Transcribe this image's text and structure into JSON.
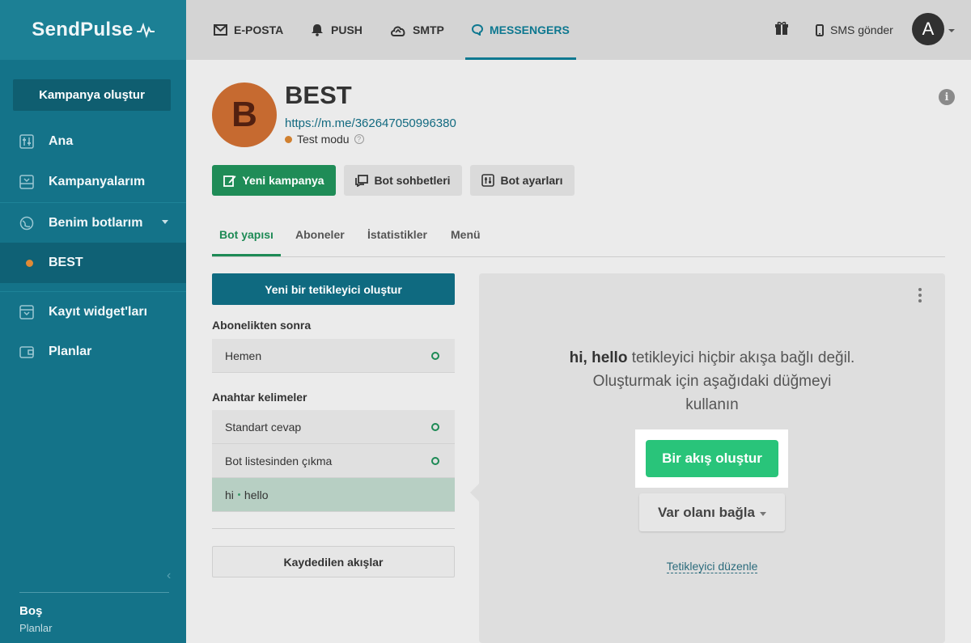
{
  "brand": {
    "logo_text": "SendPulse"
  },
  "sidebar": {
    "create_button": "Kampanya oluştur",
    "items": [
      {
        "label": "Ana",
        "icon": "sliders-icon"
      },
      {
        "label": "Kampanyalarım",
        "icon": "inbox-icon"
      },
      {
        "label": "Benim botlarım",
        "icon": "globe-icon"
      },
      {
        "label": "BEST",
        "icon": "status-dot"
      },
      {
        "label": "Kayıt widget'ları",
        "icon": "widget-icon"
      },
      {
        "label": "Planlar",
        "icon": "wallet-icon"
      }
    ],
    "footer": {
      "plan_name": "Boş",
      "plan_link": "Planlar"
    }
  },
  "topnav": {
    "items": [
      {
        "label": "E-POSTA",
        "icon": "mail-icon"
      },
      {
        "label": "PUSH",
        "icon": "bell-icon"
      },
      {
        "label": "SMTP",
        "icon": "cloud-upload-icon"
      },
      {
        "label": "MESSENGERS",
        "icon": "chat-icon"
      }
    ],
    "sms_label": "SMS gönder",
    "avatar_letter": "A"
  },
  "bot": {
    "avatar_letter": "B",
    "name": "BEST",
    "link": "https://m.me/362647050996380",
    "status": "Test modu",
    "status_color": "#d08030"
  },
  "actions": {
    "new_campaign": "Yeni kampanya",
    "bot_chats": "Bot sohbetleri",
    "bot_settings": "Bot ayarları"
  },
  "tabs": [
    "Bot yapısı",
    "Aboneler",
    "İstatistikler",
    "Menü"
  ],
  "triggers": {
    "create_button": "Yeni bir tetikleyici oluştur",
    "after_subscribe_title": "Abonelikten sonra",
    "after_subscribe_items": [
      "Hemen"
    ],
    "keywords_title": "Anahtar kelimeler",
    "keyword_items": [
      "Standart cevap",
      "Bot listesinden çıkma"
    ],
    "selected_item": {
      "part1": "hi",
      "part2": "hello"
    },
    "saved_flows_button": "Kaydedilen akışlar"
  },
  "panel": {
    "message_bold": "hi, hello",
    "message_rest": " tetikleyici hiçbir akışa bağlı değil. Oluşturmak için aşağıdaki düğmeyi kullanın",
    "create_flow_button": "Bir akış oluştur",
    "link_existing_button": "Var olanı bağla",
    "edit_trigger_link": "Tetikleyici düzenle"
  },
  "colors": {
    "sidebar_bg": "#147389",
    "accent_green": "#29c47a",
    "accent_blue": "#0e7890"
  }
}
